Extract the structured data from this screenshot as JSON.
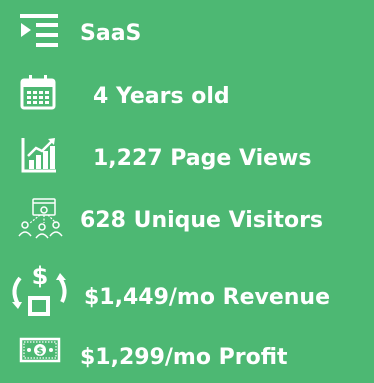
{
  "stats": [
    {
      "icon": "list-icon",
      "label": "SaaS"
    },
    {
      "icon": "calendar-icon",
      "label": "4 Years old"
    },
    {
      "icon": "bar-chart-icon",
      "label": "1,227 Page Views"
    },
    {
      "icon": "network-users-icon",
      "label": "628 Unique Visitors"
    },
    {
      "icon": "revenue-cycle-icon",
      "label": "$1,449/mo Revenue"
    },
    {
      "icon": "banknote-icon",
      "label": "$1,299/mo Profit"
    }
  ],
  "colors": {
    "background": "#4db873",
    "foreground": "#ffffff"
  }
}
